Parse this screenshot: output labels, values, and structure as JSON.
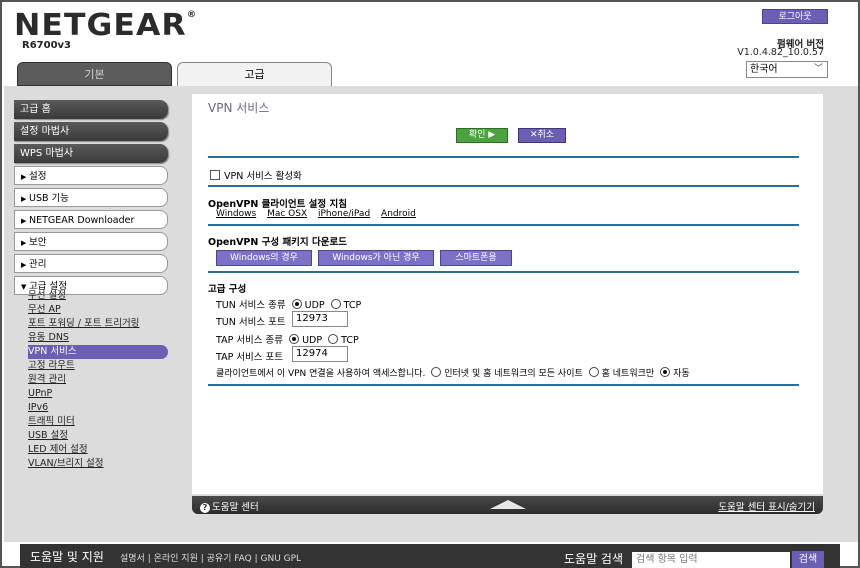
{
  "header": {
    "logo": "NETGEAR",
    "model": "R6700v3",
    "logout": "로그아웃",
    "firmware_label": "펌웨어 버전",
    "firmware_version": "V1.0.4.82_10.0.57",
    "language": "한국어"
  },
  "tabs": {
    "basic": "기본",
    "advanced": "고급"
  },
  "sidebar": {
    "main": [
      "고급 홈",
      "설정 마법사",
      "WPS 마법사"
    ],
    "sections": [
      {
        "arrow": "▶",
        "label": "설정"
      },
      {
        "arrow": "▶",
        "label": "USB 기능"
      },
      {
        "arrow": "▶",
        "label": "NETGEAR Downloader"
      },
      {
        "arrow": "▶",
        "label": "보안"
      },
      {
        "arrow": "▶",
        "label": "관리"
      },
      {
        "arrow": "▼",
        "label": "고급 설정"
      }
    ],
    "sub_items": [
      "무선 설정",
      "무선 AP",
      "포트 포워딩 / 포트 트리거링",
      "유동 DNS",
      "VPN 서비스",
      "고정 라우트",
      "원격 관리",
      "UPnP",
      "IPv6",
      "트래픽 미터",
      "USB 설정",
      "LED 제어 설정",
      "VLAN/브리지 설정"
    ]
  },
  "main": {
    "title": "VPN 서비스",
    "apply": "확인 ▶",
    "cancel": "✕취소",
    "enable_label": "VPN 서비스 활성화",
    "guide_heading": "OpenVPN 클라이언트 설정 지침",
    "guide_links": [
      "Windows",
      "Mac OSX",
      "iPhone/iPad",
      "Android"
    ],
    "download_heading": "OpenVPN 구성 패키지 다운로드",
    "download_buttons": [
      "Windows의 경우",
      "Windows가 아닌 경우",
      "스마트폰용"
    ],
    "advanced_heading": "고급 구성",
    "tun_type_label": "TUN 서비스 종류",
    "tun_port_label": "TUN 서비스 포트",
    "tun_port": "12973",
    "tap_type_label": "TAP 서비스 종류",
    "tap_port_label": "TAP 서비스 포트",
    "tap_port": "12974",
    "udp": "UDP",
    "tcp": "TCP",
    "client_access_label": "클라이언트에서 이 VPN 연결을 사용하여 액세스합니다.",
    "opt_all": "인터넷 및 홈 네트워크의 모든 사이트",
    "opt_home": "홈 네트워크만",
    "opt_auto": "자동"
  },
  "help_bar": {
    "left": "도움말 센터",
    "right": "도움말 센터 표시/숨기기"
  },
  "footer": {
    "title": "도움말 및 지원",
    "links": "설명서 | 온라인 지원 | 공유기 FAQ | GNU GPL",
    "search_label": "도움말 검색",
    "search_placeholder": "검색 항목 입력",
    "search_button": "검색"
  }
}
